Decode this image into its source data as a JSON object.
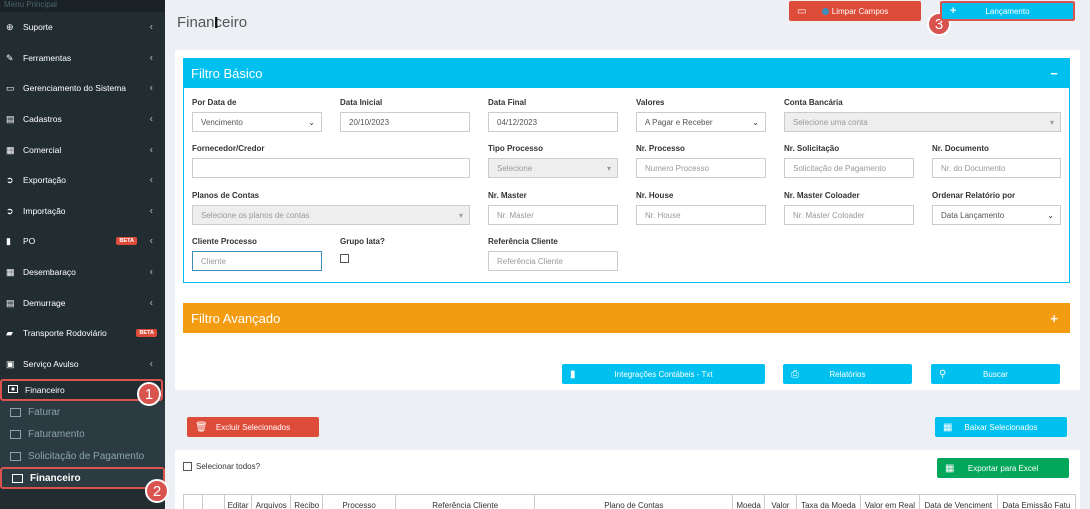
{
  "sidebar": {
    "header": "Menu Principal",
    "items": [
      {
        "label": "Suporte",
        "icon": "globe-icon",
        "chevron": true
      },
      {
        "label": "Ferramentas",
        "icon": "wrench-icon",
        "chevron": true
      },
      {
        "label": "Gerenciamento do Sistema",
        "icon": "desktop-icon",
        "chevron": true
      },
      {
        "label": "Cadastros",
        "icon": "file-icon",
        "chevron": true
      },
      {
        "label": "Comercial",
        "icon": "briefcase-icon",
        "chevron": true
      },
      {
        "label": "Exportação",
        "icon": "arrow-circle-right-icon",
        "chevron": true
      },
      {
        "label": "Importação",
        "icon": "arrow-circle-left-icon",
        "chevron": true
      },
      {
        "label": "PO",
        "icon": "bar-chart-icon",
        "chevron": true,
        "badge": "BETA"
      },
      {
        "label": "Desembaraço",
        "icon": "calculator-icon",
        "chevron": true
      },
      {
        "label": "Demurrage",
        "icon": "file-icon",
        "chevron": true
      },
      {
        "label": "Transporte Rodoviário",
        "icon": "truck-icon",
        "chevron": false,
        "badge": "BETA"
      },
      {
        "label": "Serviço Avulso",
        "icon": "money-icon",
        "chevron": true
      }
    ],
    "active_parent": "Financeiro",
    "sub_items": [
      "Faturar",
      "Faturamento",
      "Solicitação de Pagamento",
      "Financeiro"
    ]
  },
  "annotations": [
    "1",
    "2",
    "3"
  ],
  "page": {
    "title": "Financeiro"
  },
  "toolbar": {
    "clear_label": "Limpar Campos",
    "launch_label": "Lançamento"
  },
  "basic_filter": {
    "title": "Filtro Básico",
    "toggle": "−",
    "fields": {
      "por_data_de": {
        "label": "Por Data de",
        "value": "Vencimento"
      },
      "data_inicial": {
        "label": "Data Inicial",
        "value": "20/10/2023"
      },
      "data_final": {
        "label": "Data Final",
        "value": "04/12/2023"
      },
      "valores": {
        "label": "Valores",
        "value": "A Pagar e Receber"
      },
      "conta_bancaria": {
        "label": "Conta Bancária",
        "placeholder": "Selecione uma conta"
      },
      "fornecedor": {
        "label": "Fornecedor/Credor",
        "value": ""
      },
      "tipo_processo": {
        "label": "Tipo Processo",
        "placeholder": "Selecione"
      },
      "nr_processo": {
        "label": "Nr. Processo",
        "placeholder": "Numero Processo"
      },
      "nr_solicitacao": {
        "label": "Nr. Solicitação",
        "placeholder": "Solicitação de Pagamento"
      },
      "nr_documento": {
        "label": "Nr. Documento",
        "placeholder": "Nr. do Documento"
      },
      "planos_contas": {
        "label": "Planos de Contas",
        "placeholder": "Selecione os planos de contas"
      },
      "nr_master": {
        "label": "Nr. Master",
        "placeholder": "Nr. Master"
      },
      "nr_house": {
        "label": "Nr. House",
        "placeholder": "Nr. House"
      },
      "nr_master_coloader": {
        "label": "Nr. Master Coloader",
        "placeholder": "Nr. Master Coloader"
      },
      "ordenar": {
        "label": "Ordenar Relatório por",
        "value": "Data Lançamento"
      },
      "cliente_processo": {
        "label": "Cliente Processo",
        "placeholder": "Cliente"
      },
      "grupo_iata": {
        "label": "Grupo Iata?"
      },
      "referencia_cliente": {
        "label": "Referência Cliente",
        "placeholder": "Referência Cliente"
      }
    }
  },
  "advanced_filter": {
    "title": "Filtro Avançado",
    "toggle": "+"
  },
  "actions": {
    "integracoes": "Integrações Contábeis - Txt",
    "relatorios": "Relatórios",
    "buscar": "Buscar"
  },
  "bulk": {
    "excluir": "Excluir Selecionados",
    "baixar": "Baixar Selecionados"
  },
  "table": {
    "select_all": "Selecionar todos?",
    "export": "Exportar para Excel",
    "columns": [
      "",
      "",
      "Editar",
      "Arquivos",
      "Recibo",
      "Processo",
      "Referência Cliente",
      "Plano de Contas",
      "Moeda",
      "Valor",
      "Taxa da Moeda",
      "Valor em Real",
      "Data de Venciment",
      "Data Emissão Fatu"
    ]
  },
  "colors": {
    "sidebar": "#222d32",
    "primary": "#00c0ef",
    "danger": "#dd4b39",
    "warning": "#f39c12",
    "success": "#00a65a",
    "annotation": "#d9534f"
  }
}
